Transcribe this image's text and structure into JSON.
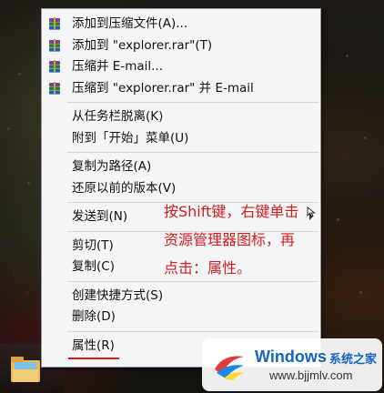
{
  "menu": {
    "groups": [
      [
        {
          "label": "添加到压缩文件(A)...",
          "icon": "winrar-icon"
        },
        {
          "label": "添加到 \"explorer.rar\"(T)",
          "icon": "winrar-icon"
        },
        {
          "label": "压缩并 E-mail...",
          "icon": "winrar-icon"
        },
        {
          "label": "压缩到 \"explorer.rar\" 并 E-mail",
          "icon": "winrar-icon"
        }
      ],
      [
        {
          "label": "从任务栏脱离(K)"
        },
        {
          "label": "附到「开始」菜单(U)"
        }
      ],
      [
        {
          "label": "复制为路径(A)"
        },
        {
          "label": "还原以前的版本(V)"
        }
      ],
      [
        {
          "label": "发送到(N)",
          "submenu": true
        }
      ],
      [
        {
          "label": "剪切(T)"
        },
        {
          "label": "复制(C)"
        }
      ],
      [
        {
          "label": "创建快捷方式(S)"
        },
        {
          "label": "删除(D)"
        }
      ],
      [
        {
          "label": "属性(R)"
        }
      ]
    ]
  },
  "annotation": {
    "lines": [
      "按Shift键，右键单击",
      "资源管理器图标，再",
      "点击：属性。"
    ],
    "color": "#d21d1d"
  },
  "watermark": {
    "brand": "Windows",
    "sub": "系统之家",
    "url": "www.bjjmlv.com"
  },
  "taskbar": {
    "icon": "file-explorer-icon"
  }
}
